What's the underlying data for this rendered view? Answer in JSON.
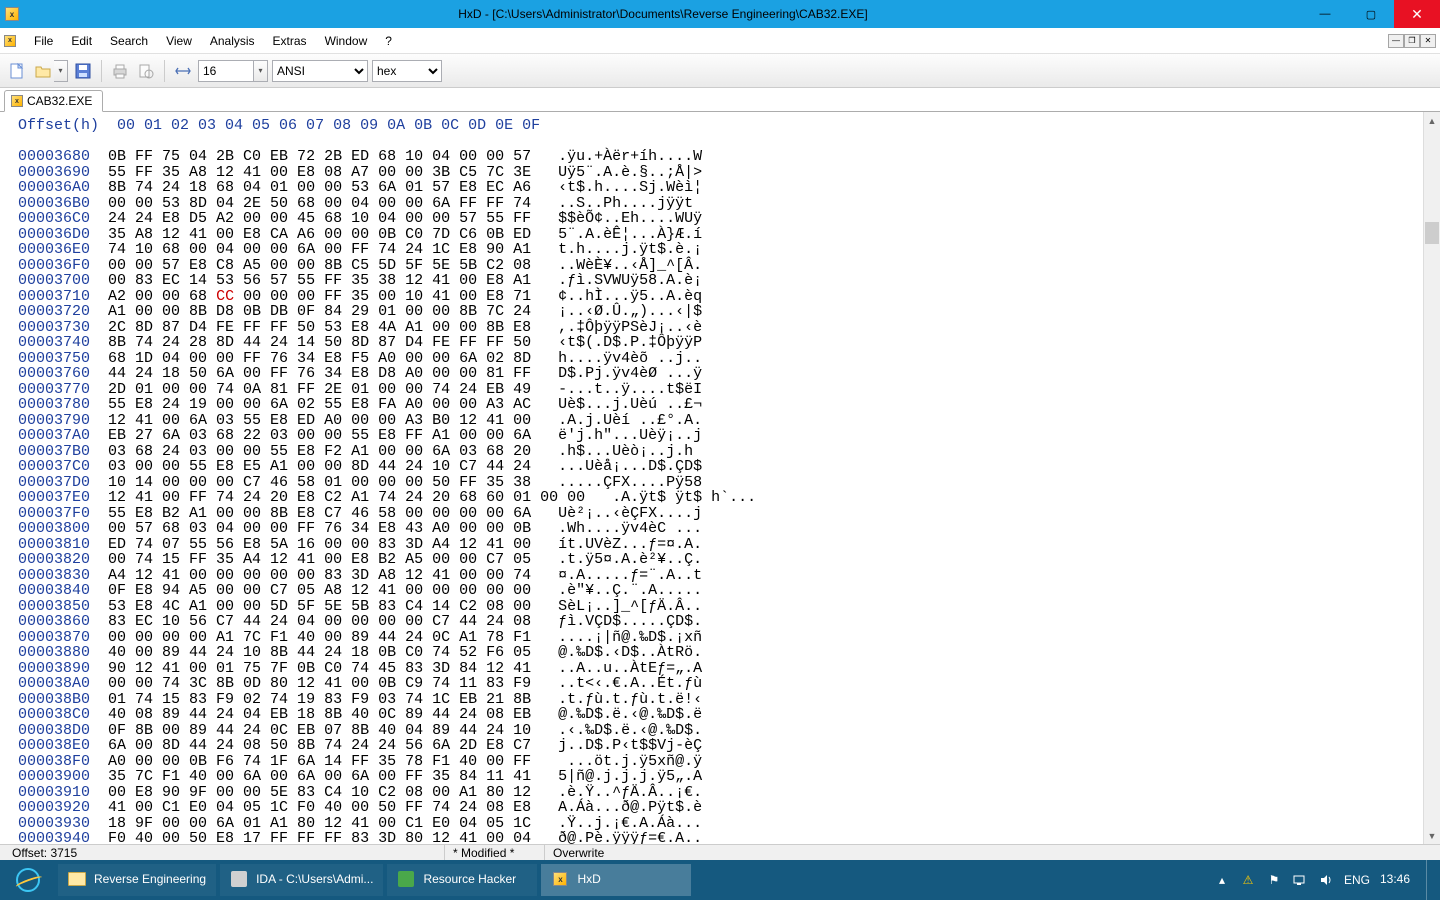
{
  "window": {
    "title": "HxD - [C:\\Users\\Administrator\\Documents\\Reverse Engineering\\CAB32.EXE]"
  },
  "menu": {
    "items": [
      "File",
      "Edit",
      "Search",
      "View",
      "Analysis",
      "Extras",
      "Window",
      "?"
    ]
  },
  "toolbar": {
    "bytes_per_row": "16",
    "charset": "ANSI",
    "numbase": "hex"
  },
  "tab": {
    "label": "CAB32.EXE"
  },
  "hex": {
    "header_offset": "Offset(h)",
    "header_cols": "00 01 02 03 04 05 06 07 08 09 0A 0B 0C 0D 0E 0F",
    "rows": [
      {
        "o": "00003680",
        "h": "0B FF 75 04 2B C0 EB 72 2B ED 68 10 04 00 00 57",
        "a": ".ÿu.+Àër+íh....W"
      },
      {
        "o": "00003690",
        "h": "55 FF 35 A8 12 41 00 E8 08 A7 00 00 3B C5 7C 3E",
        "a": "Uÿ5¨.A.è.§..;Å|>"
      },
      {
        "o": "000036A0",
        "h": "8B 74 24 18 68 04 01 00 00 53 6A 01 57 E8 EC A6",
        "a": "‹t$.h....Sj.Wèì¦"
      },
      {
        "o": "000036B0",
        "h": "00 00 53 8D 04 2E 50 68 00 04 00 00 6A FF FF 74",
        "a": "..S..Ph....jÿÿt"
      },
      {
        "o": "000036C0",
        "h": "24 24 E8 D5 A2 00 00 45 68 10 04 00 00 57 55 FF",
        "a": "$$èÕ¢..Eh....WUÿ"
      },
      {
        "o": "000036D0",
        "h": "35 A8 12 41 00 E8 CA A6 00 00 0B C0 7D C6 0B ED",
        "a": "5¨.A.èÊ¦...À}Æ.í"
      },
      {
        "o": "000036E0",
        "h": "74 10 68 00 04 00 00 6A 00 FF 74 24 1C E8 90 A1",
        "a": "t.h....j.ÿt$.è.¡"
      },
      {
        "o": "000036F0",
        "h": "00 00 57 E8 C8 A5 00 00 8B C5 5D 5F 5E 5B C2 08",
        "a": "..WèÈ¥..‹Å]_^[Â."
      },
      {
        "o": "00003700",
        "h": "00 83 EC 14 53 56 57 55 FF 35 38 12 41 00 E8 A1",
        "a": ".ƒì.SVWUÿ58.A.è¡"
      },
      {
        "o": "00003710",
        "h": "A2 00 00 68 ",
        "hm": "CC",
        "h2": " 00 00 00 FF 35 00 10 41 00 E8 71",
        "a": "¢..hÌ...ÿ5..A.èq"
      },
      {
        "o": "00003720",
        "h": "A1 00 00 8B D8 0B DB 0F 84 29 01 00 00 8B 7C 24",
        "a": "¡..‹Ø.Û.„)...‹|$"
      },
      {
        "o": "00003730",
        "h": "2C 8D 87 D4 FE FF FF 50 53 E8 4A A1 00 00 8B E8",
        "a": ",.‡ÔþÿÿPSèJ¡..‹è"
      },
      {
        "o": "00003740",
        "h": "8B 74 24 28 8D 44 24 14 50 8D 87 D4 FE FF FF 50",
        "a": "‹t$(.D$.P.‡ÔþÿÿP"
      },
      {
        "o": "00003750",
        "h": "68 1D 04 00 00 FF 76 34 E8 F5 A0 00 00 6A 02 8D",
        "a": "h....ÿv4èõ ..j.."
      },
      {
        "o": "00003760",
        "h": "44 24 18 50 6A 00 FF 76 34 E8 D8 A0 00 00 81 FF",
        "a": "D$.Pj.ÿv4èØ ...ÿ"
      },
      {
        "o": "00003770",
        "h": "2D 01 00 00 74 0A 81 FF 2E 01 00 00 74 24 EB 49",
        "a": "-...t..ÿ....t$ëI"
      },
      {
        "o": "00003780",
        "h": "55 E8 24 19 00 00 6A 02 55 E8 FA A0 00 00 A3 AC",
        "a": "Uè$...j.Uèú ..£¬"
      },
      {
        "o": "00003790",
        "h": "12 41 00 6A 03 55 E8 ED A0 00 00 A3 B0 12 41 00",
        "a": ".A.j.Uèí ..£°.A."
      },
      {
        "o": "000037A0",
        "h": "EB 27 6A 03 68 22 03 00 00 55 E8 FF A1 00 00 6A",
        "a": "ë'j.h\"...Uèÿ¡..j"
      },
      {
        "o": "000037B0",
        "h": "03 68 24 03 00 00 55 E8 F2 A1 00 00 6A 03 68 20",
        "a": ".h$...Uèò¡..j.h "
      },
      {
        "o": "000037C0",
        "h": "03 00 00 55 E8 E5 A1 00 00 8D 44 24 10 C7 44 24",
        "a": "...Uèå¡...D$.ÇD$"
      },
      {
        "o": "000037D0",
        "h": "10 14 00 00 00 C7 46 58 01 00 00 00 50 FF 35 38",
        "a": ".....ÇFX....Pÿ58"
      },
      {
        "o": "000037E0",
        "h": "12 41 00 FF 74 24 20 E8 C2 A1 74 24 20 68 60 01 00 00",
        "a": ".A.ÿt$ ÿt$ h`..."
      },
      {
        "o": "000037F0",
        "h": "55 E8 B2 A1 00 00 8B E8 C7 46 58 00 00 00 00 6A",
        "a": "Uè²¡..‹èÇFX....j"
      },
      {
        "o": "00003800",
        "h": "00 57 68 03 04 00 00 FF 76 34 E8 43 A0 00 00 0B",
        "a": ".Wh....ÿv4èC ..."
      },
      {
        "o": "00003810",
        "h": "ED 74 07 55 56 E8 5A 16 00 00 83 3D A4 12 41 00",
        "a": "ít.UVèZ...ƒ=¤.A."
      },
      {
        "o": "00003820",
        "h": "00 74 15 FF 35 A4 12 41 00 E8 B2 A5 00 00 C7 05",
        "a": ".t.ÿ5¤.A.è²¥..Ç."
      },
      {
        "o": "00003830",
        "h": "A4 12 41 00 00 00 00 00 83 3D A8 12 41 00 00 74",
        "a": "¤.A.....ƒ=¨.A..t"
      },
      {
        "o": "00003840",
        "h": "0F E8 94 A5 00 00 C7 05 A8 12 41 00 00 00 00 00",
        "a": ".è\"¥..Ç.¨.A....."
      },
      {
        "o": "00003850",
        "h": "53 E8 4C A1 00 00 5D 5F 5E 5B 83 C4 14 C2 08 00",
        "a": "SèL¡..]_^[ƒÄ.Â.."
      },
      {
        "o": "00003860",
        "h": "83 EC 10 56 C7 44 24 04 00 00 00 00 C7 44 24 08",
        "a": "ƒì.VÇD$.....ÇD$."
      },
      {
        "o": "00003870",
        "h": "00 00 00 00 A1 7C F1 40 00 89 44 24 0C A1 78 F1",
        "a": "....¡|ñ@.‰D$.¡xñ"
      },
      {
        "o": "00003880",
        "h": "40 00 89 44 24 10 8B 44 24 18 0B C0 74 52 F6 05",
        "a": "@.‰D$.‹D$..ÀtRö."
      },
      {
        "o": "00003890",
        "h": "90 12 41 00 01 75 7F 0B C0 74 45 83 3D 84 12 41",
        "a": "..A..u..ÀtEƒ=„.A"
      },
      {
        "o": "000038A0",
        "h": "00 00 74 3C 8B 0D 80 12 41 00 0B C9 74 11 83 F9",
        "a": "..t<‹.€.A..Ét.ƒù"
      },
      {
        "o": "000038B0",
        "h": "01 74 15 83 F9 02 74 19 83 F9 03 74 1C EB 21 8B",
        "a": ".t.ƒù.t.ƒù.t.ë!‹"
      },
      {
        "o": "000038C0",
        "h": "40 08 89 44 24 04 EB 18 8B 40 0C 89 44 24 08 EB",
        "a": "@.‰D$.ë.‹@.‰D$.ë"
      },
      {
        "o": "000038D0",
        "h": "0F 8B 00 89 44 24 0C EB 07 8B 40 04 89 44 24 10",
        "a": ".‹.‰D$.ë.‹@.‰D$."
      },
      {
        "o": "000038E0",
        "h": "6A 00 8D 44 24 08 50 8B 74 24 24 56 6A 2D E8 C7",
        "a": "j..D$.P‹t$$Vj-èÇ"
      },
      {
        "o": "000038F0",
        "h": "A0 00 00 0B F6 74 1F 6A 14 FF 35 78 F1 40 00 FF",
        "a": " ...öt.j.ÿ5xñ@.ÿ"
      },
      {
        "o": "00003900",
        "h": "35 7C F1 40 00 6A 00 6A 00 6A 00 FF 35 84 11 41",
        "a": "5|ñ@.j.j.j.ÿ5„.A"
      },
      {
        "o": "00003910",
        "h": "00 E8 90 9F 00 00 5E 83 C4 10 C2 08 00 A1 80 12",
        "a": ".è.Ÿ..^ƒÄ.Â..¡€."
      },
      {
        "o": "00003920",
        "h": "41 00 C1 E0 04 05 1C F0 40 00 50 FF 74 24 08 E8",
        "a": "A.Áà...ð@.Pÿt$.è"
      },
      {
        "o": "00003930",
        "h": "18 9F 00 00 6A 01 A1 80 12 41 00 C1 E0 04 05 1C",
        "a": ".Ÿ..j.¡€.A.Áà..."
      },
      {
        "o": "00003940",
        "h": "F0 40 00 50 E8 17 FF FF FF 83 3D 80 12 41 00 04",
        "a": "ð@.Pè.ÿÿÿƒ=€.A.."
      }
    ]
  },
  "status": {
    "offset_label": "Offset: 3715",
    "modified": "* Modified *",
    "mode": "Overwrite"
  },
  "taskbar": {
    "btns": [
      {
        "label": "Reverse Engineering",
        "active": false,
        "icon": "folder"
      },
      {
        "label": "IDA - C:\\Users\\Admi...",
        "active": false,
        "icon": "ida"
      },
      {
        "label": "Resource Hacker",
        "active": false,
        "icon": "rh"
      },
      {
        "label": "HxD",
        "active": true,
        "icon": "hxd"
      }
    ],
    "lang": "ENG",
    "time": "13:46"
  }
}
